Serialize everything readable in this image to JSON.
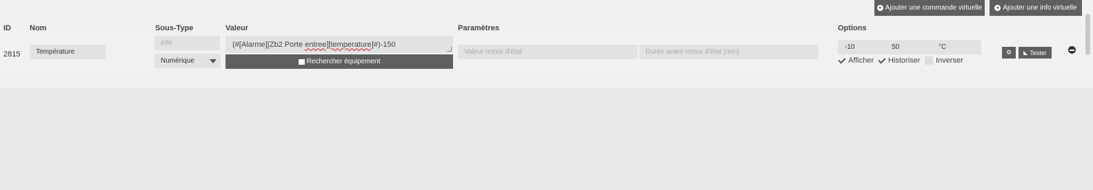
{
  "toolbar": {
    "add_command_label": "Ajouter une commande virtuelle",
    "add_info_label": "Ajouter une info virtuelle"
  },
  "headers": {
    "id": "ID",
    "name": "Nom",
    "subtype": "Sous-Type",
    "value": "Valeur",
    "params": "Paramètres",
    "options": "Options"
  },
  "row": {
    "id": "2815",
    "name": "Température",
    "type": "info",
    "subtype": "Numérique",
    "value_prefix": "(#[Alarme][Zb2 Porte ",
    "value_misspelled": "entree][temperature]",
    "value_suffix": "#)-150",
    "search_button": "Rechercher équipement",
    "state_return_placeholder": "Valeur retour d'état",
    "state_delay_placeholder": "Durée avant retour d'état (min)",
    "min": "-10",
    "max": "50",
    "unit": "°C",
    "display_label": "Afficher",
    "historize_label": "Historiser",
    "invert_label": "Inverser",
    "display_checked": true,
    "historize_checked": true,
    "invert_checked": false,
    "test_button": "Tester"
  },
  "icons": {
    "add": "plus-circle-icon",
    "search": "list-icon",
    "config": "gears-icon",
    "test": "rss-icon",
    "remove": "minus-circle-icon"
  }
}
